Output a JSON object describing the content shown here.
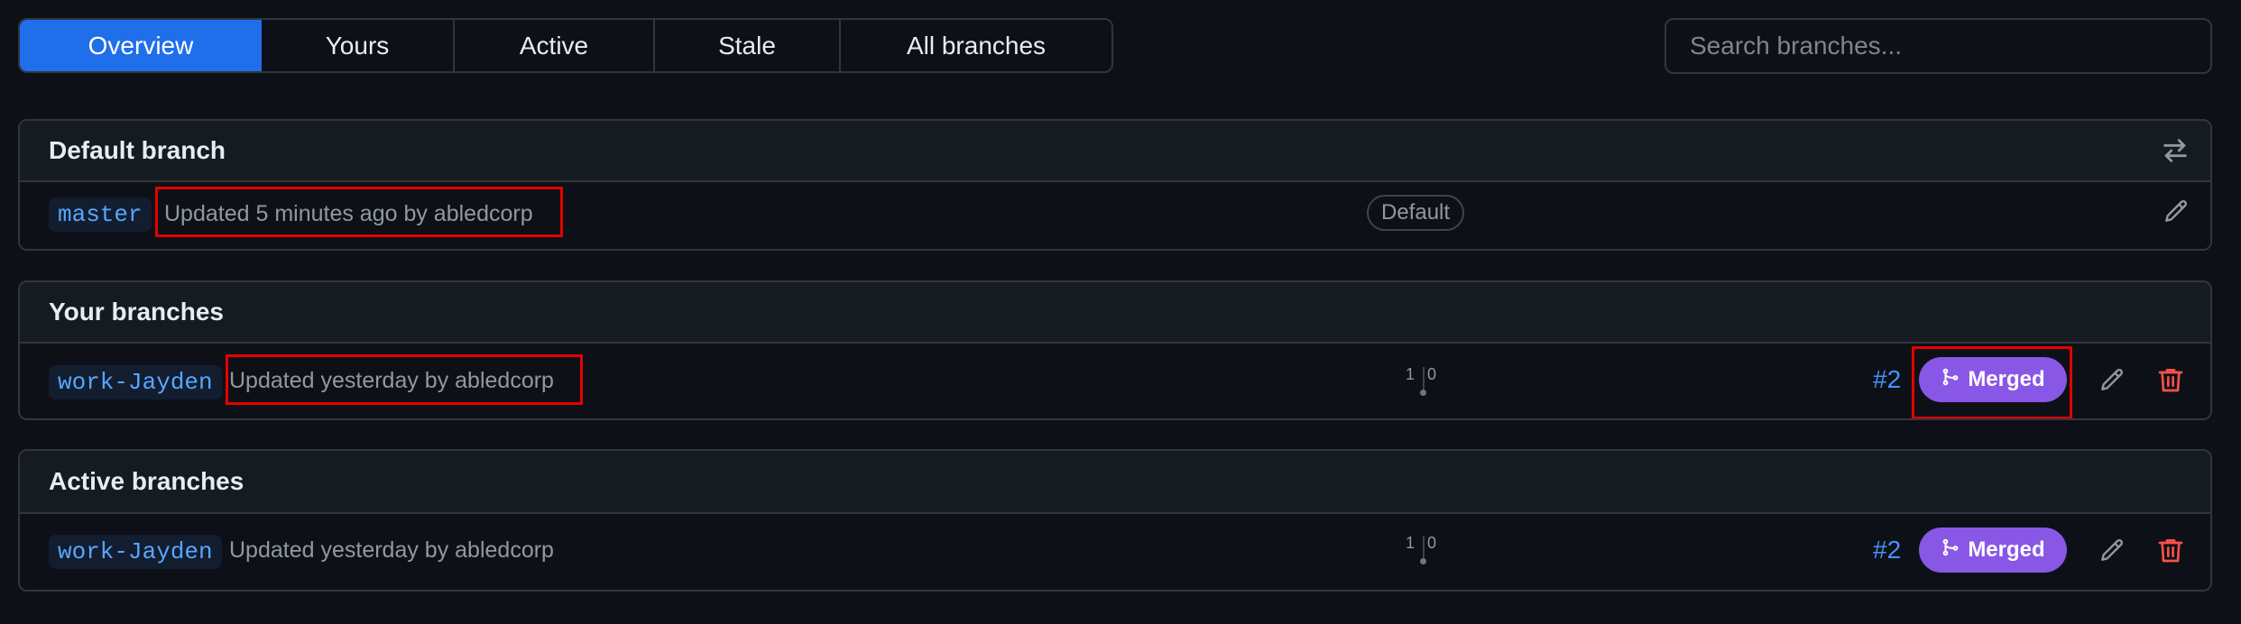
{
  "tabs": [
    {
      "label": "Overview",
      "active": true
    },
    {
      "label": "Yours",
      "active": false
    },
    {
      "label": "Active",
      "active": false
    },
    {
      "label": "Stale",
      "active": false
    },
    {
      "label": "All branches",
      "active": false
    }
  ],
  "search": {
    "placeholder": "Search branches..."
  },
  "default_section": {
    "title": "Default branch",
    "branch": "master",
    "updated": "Updated 5 minutes ago by abledcorp",
    "badge": "Default"
  },
  "your_section": {
    "title": "Your branches",
    "branch": "work-Jayden",
    "updated": "Updated yesterday by abledcorp",
    "ahead": "1",
    "behind": "0",
    "pr": "#2",
    "status": "Merged"
  },
  "active_section": {
    "title": "Active branches",
    "branch": "work-Jayden",
    "updated": "Updated yesterday by abledcorp",
    "ahead": "1",
    "behind": "0",
    "pr": "#2",
    "status": "Merged"
  },
  "colors": {
    "accent": "#1f6feb",
    "merged": "#8957e5",
    "delete": "#f85149",
    "highlight": "#e60000"
  },
  "icons": [
    "switch-icon",
    "pencil-icon",
    "trash-icon",
    "git-merge-icon"
  ]
}
